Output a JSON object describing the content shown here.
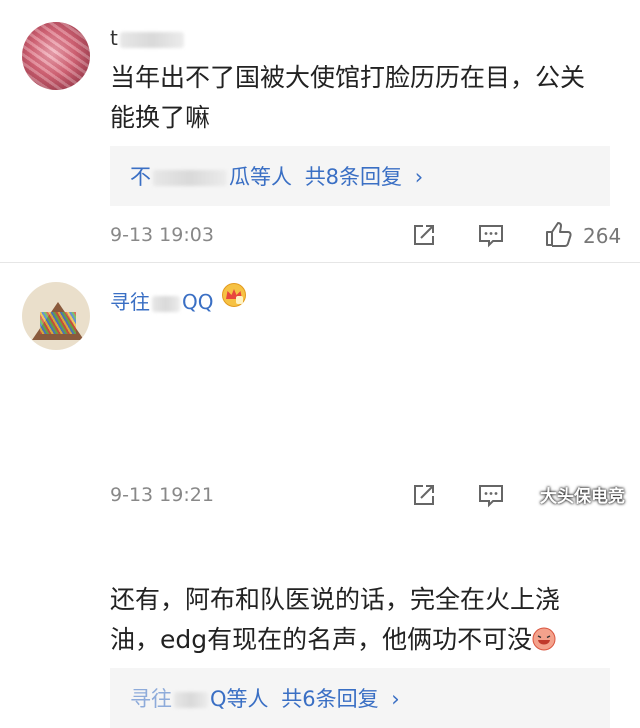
{
  "comments": [
    {
      "username": "t",
      "text_line1": "当年出不了国被大使馆打脸历历在目，公关",
      "text_line2": "能换了嘛",
      "reply_prefix": "不",
      "reply_suffix": "瓜等人",
      "reply_count": "共8条回复",
      "reply_chevron": "›",
      "time": "9-13 19:03",
      "likes": "264",
      "avatar": "pink-blurred-avatar"
    },
    {
      "username": "寻往",
      "username_suffix": "QQ",
      "text_line1": "还有，阿布和队医说的话，完全在火上浇",
      "text_line2": "油，edg有现在的名声，他俩功不可没",
      "reply_prefix": "寻往",
      "reply_suffix": "Q等人",
      "reply_count": "共6条回复",
      "reply_chevron": "›",
      "time": "9-13 19:21",
      "avatar": "pizza-avatar"
    }
  ],
  "icons": [
    "share-icon",
    "comment-icon",
    "like-icon",
    "crown-badge-icon",
    "laughing-emoji-icon"
  ],
  "watermark": "大头保电竞",
  "colors": {
    "link": "#3a6fc4",
    "meta": "#888888",
    "reply_bg": "#f5f5f5"
  }
}
